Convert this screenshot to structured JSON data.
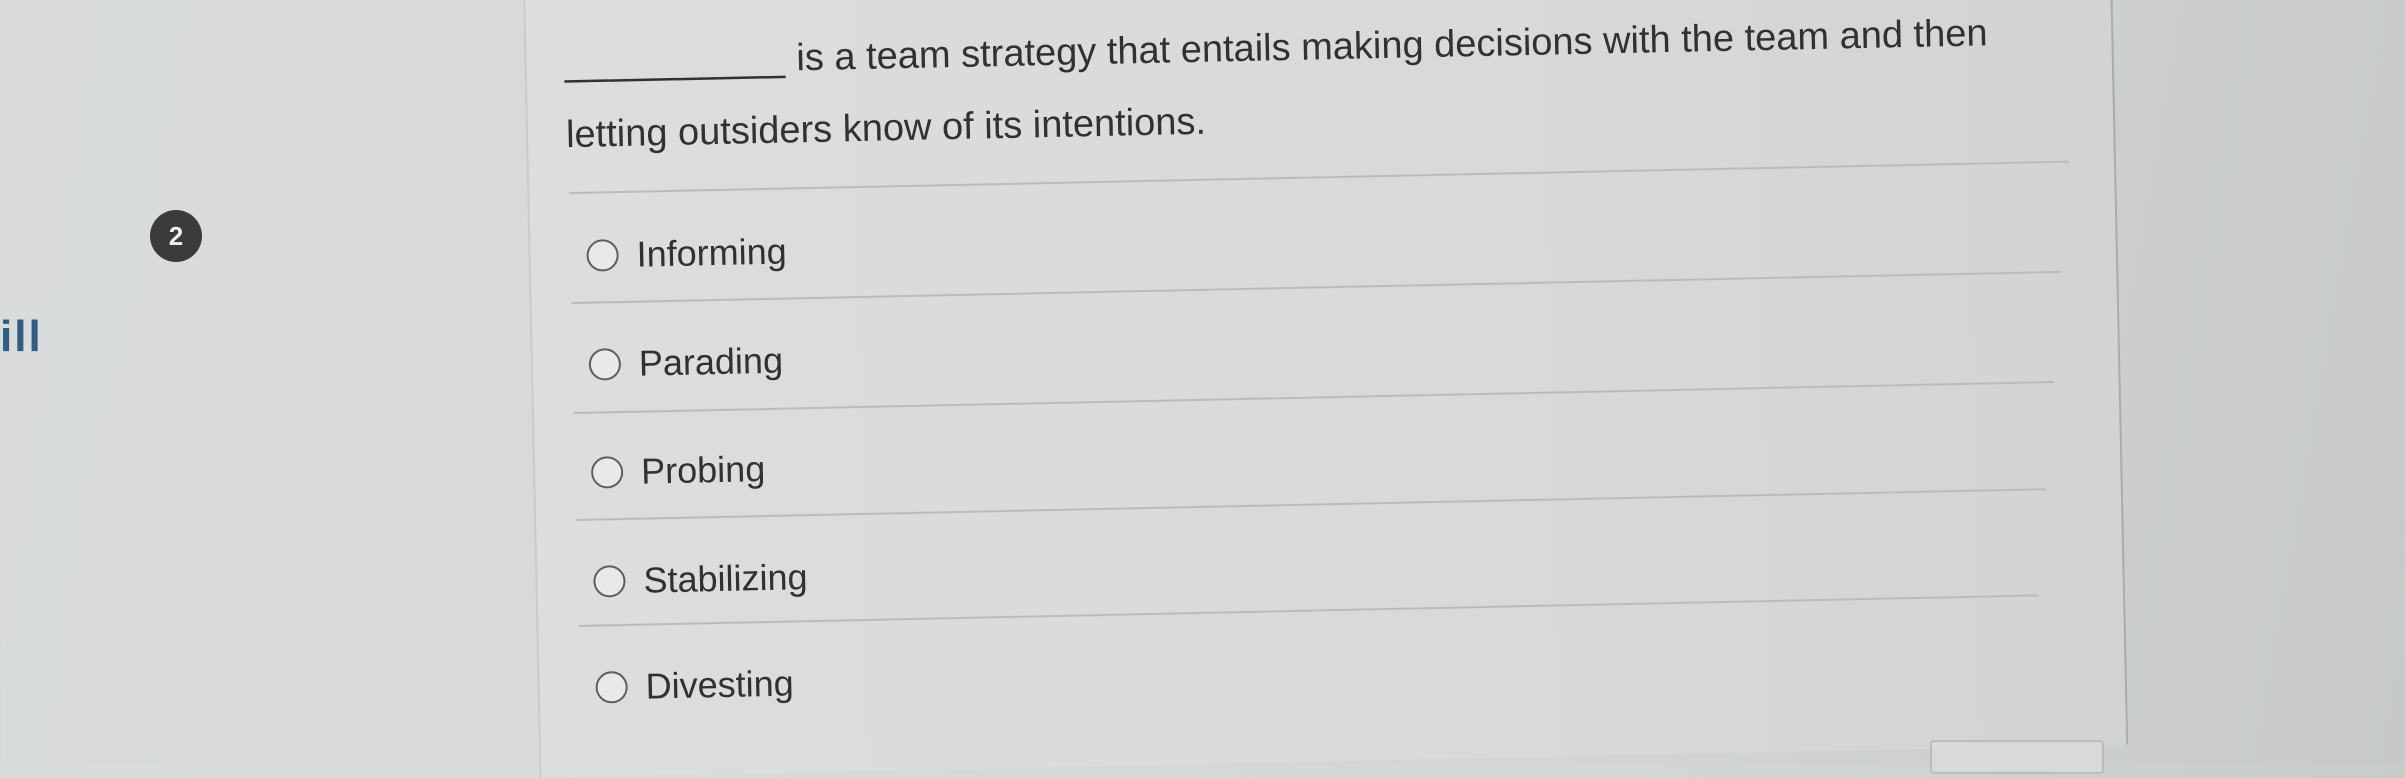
{
  "page": {
    "edge_fragment": "ill"
  },
  "question": {
    "number": "2",
    "blank": "__________",
    "text_after_blank": " is a team strategy that entails making decisions with the team and then letting outsiders know of its intentions."
  },
  "options": [
    {
      "label": "Informing",
      "selected": false
    },
    {
      "label": "Parading",
      "selected": false
    },
    {
      "label": "Probing",
      "selected": false
    },
    {
      "label": "Stabilizing",
      "selected": false
    },
    {
      "label": "Divesting",
      "selected": false
    }
  ]
}
